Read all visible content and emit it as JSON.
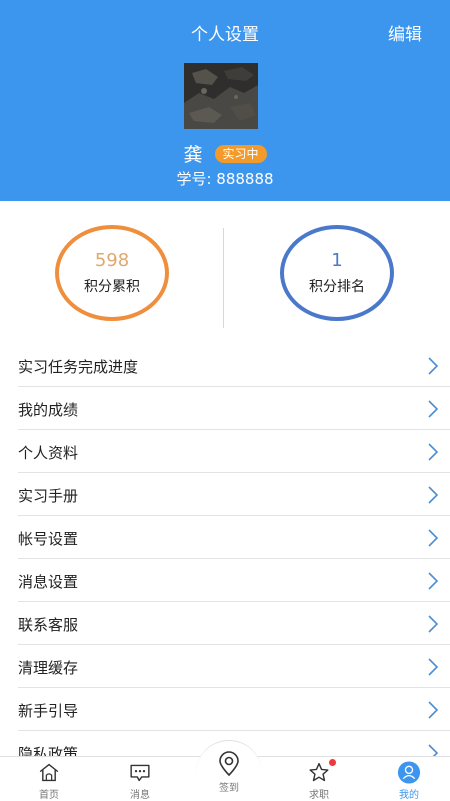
{
  "header": {
    "title": "个人设置",
    "edit_label": "编辑",
    "name": "龚",
    "status_badge": "实习中",
    "student_id_label": "学号:",
    "student_id": "888888",
    "background_color": "#3d96ee",
    "badge_color": "#f39a2c"
  },
  "stats": {
    "points_total": {
      "value": "598",
      "label": "积分累积",
      "color": "#ef8f3e"
    },
    "points_rank": {
      "value": "1",
      "label": "积分排名",
      "color": "#4a78cb"
    }
  },
  "menu": {
    "items": [
      {
        "label": "实习任务完成进度"
      },
      {
        "label": "我的成绩"
      },
      {
        "label": "个人资料"
      },
      {
        "label": "实习手册"
      },
      {
        "label": "帐号设置"
      },
      {
        "label": "消息设置"
      },
      {
        "label": "联系客服"
      },
      {
        "label": "清理缓存"
      },
      {
        "label": "新手引导"
      },
      {
        "label": "隐私政策"
      }
    ],
    "chevron_icon": "chevron-right-icon"
  },
  "tabbar": {
    "tabs": [
      {
        "label": "首页",
        "icon": "home-icon"
      },
      {
        "label": "消息",
        "icon": "message-icon"
      },
      {
        "label": "签到",
        "icon": "location-pin-icon"
      },
      {
        "label": "求职",
        "icon": "star-icon"
      },
      {
        "label": "我的",
        "icon": "user-icon"
      }
    ],
    "active_color": "#3d96ee"
  }
}
